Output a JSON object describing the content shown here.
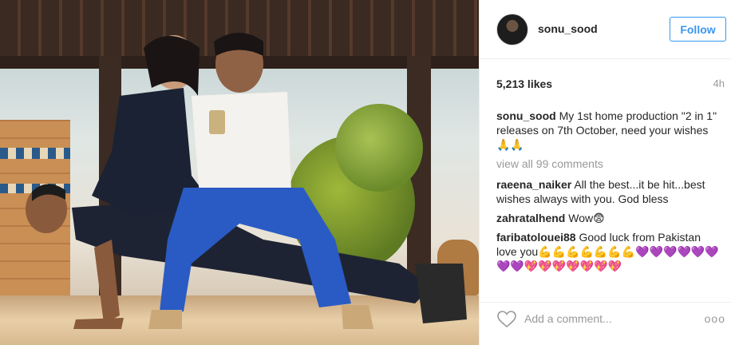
{
  "post": {
    "username": "sonu_sood",
    "follow_label": "Follow",
    "likes": "5,213 likes",
    "time_ago": "4h",
    "caption": {
      "username": "sonu_sood",
      "text": "My 1st home production \"2 in 1\" releases on 7th October, need your wishes🙏🙏"
    },
    "view_all": "view all 99 comments",
    "comments": [
      {
        "username": "raeena_naiker",
        "text": "All the best...it be hit...best wishes always with you. God bless"
      },
      {
        "username": "zahratalhend",
        "text": "Wow😨"
      },
      {
        "username": "faribatolouei88",
        "text": "Good luck from Pakistan love you💪💪💪💪💪💪💪💜💜💜💜💜💜💜💜💖💖💖💖💖💖💖"
      }
    ],
    "add_comment_placeholder": "Add a comment...",
    "more_label": "ooo"
  },
  "icons": {
    "heart": "heart-icon",
    "more": "more-options-icon"
  },
  "colors": {
    "accent": "#3897f0",
    "muted": "#999999",
    "text": "#262626"
  }
}
